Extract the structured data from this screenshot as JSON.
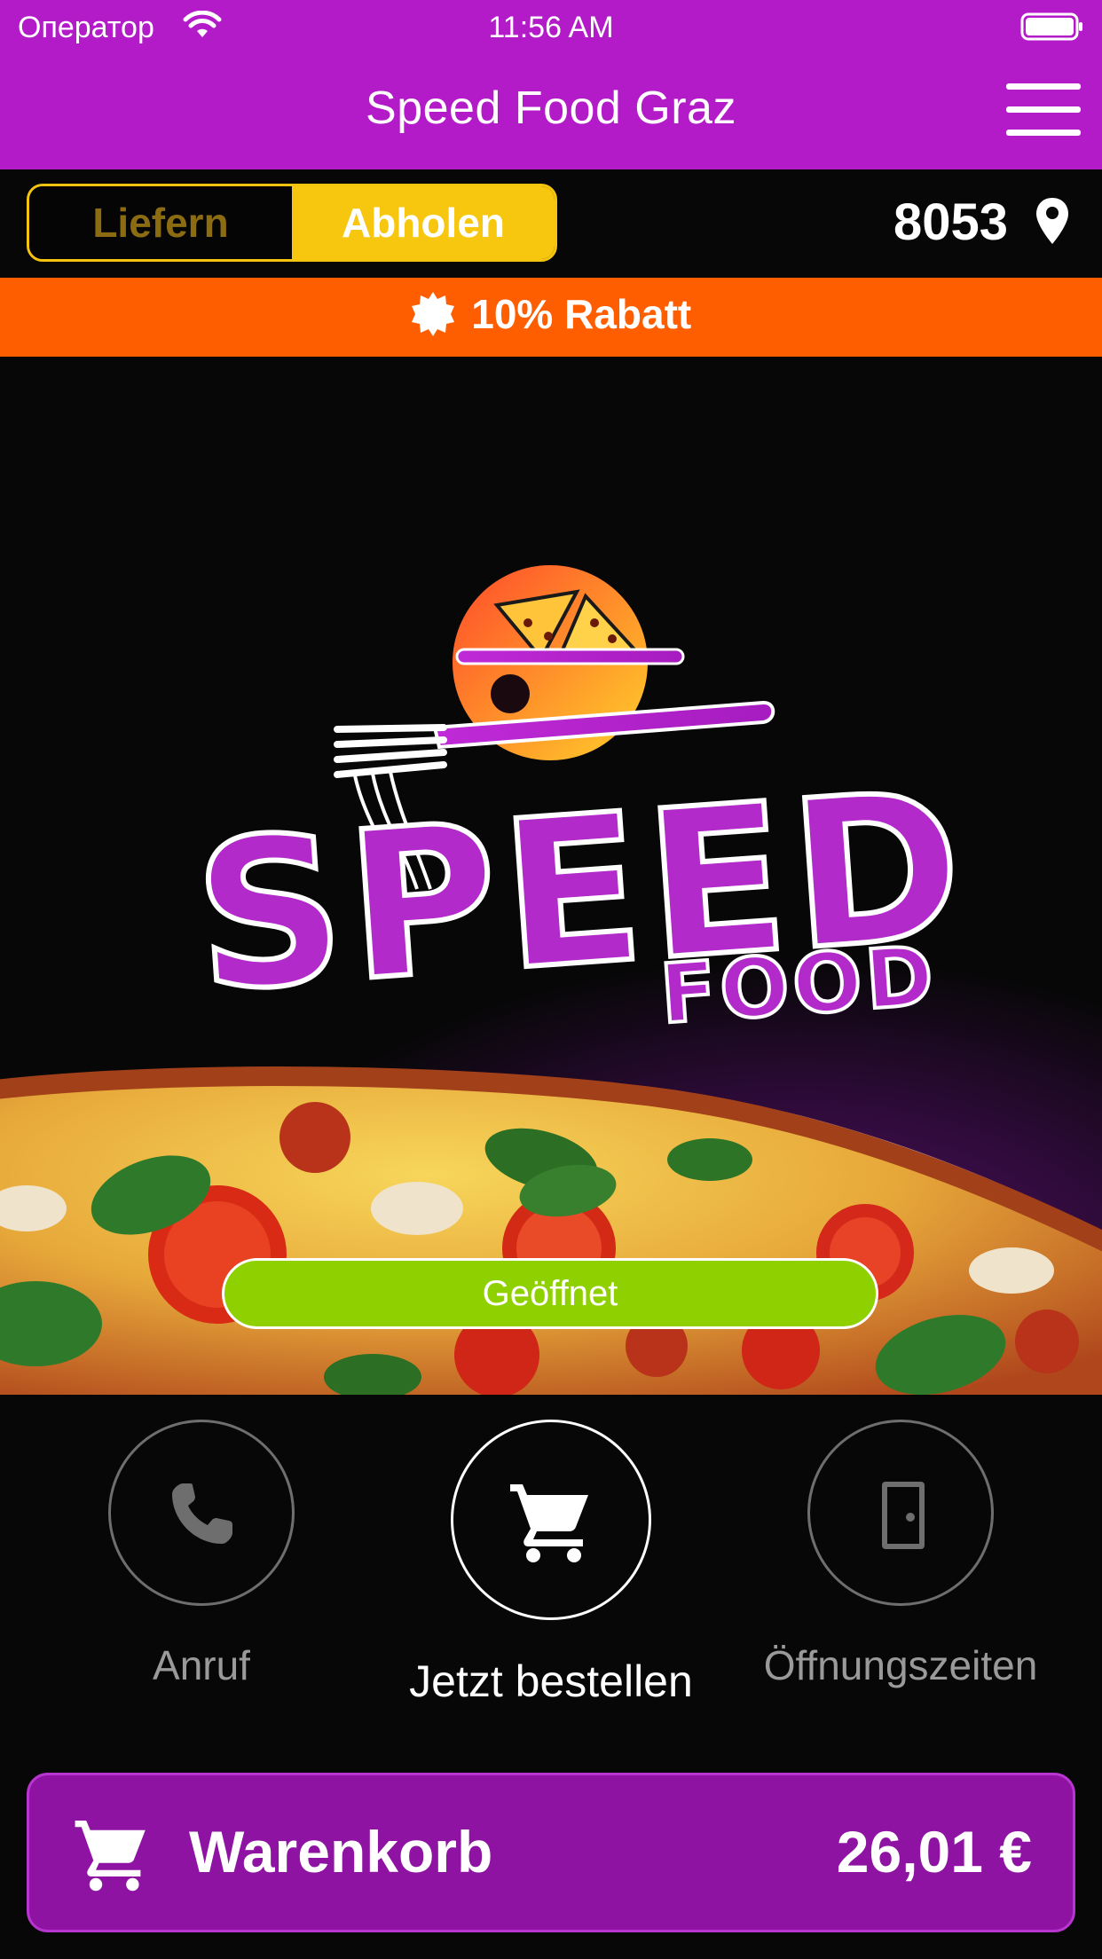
{
  "status_bar": {
    "carrier": "Оператор",
    "time": "11:56 AM"
  },
  "header": {
    "title": "Speed Food Graz",
    "menu_icon": "hamburger-menu-icon"
  },
  "mode_toggle": {
    "options": [
      "Liefern",
      "Abholen"
    ],
    "selected": "Abholen"
  },
  "location": {
    "postal_code": "8053",
    "icon": "location-pin-icon"
  },
  "discount": {
    "text": "10% Rabatt",
    "icon": "badge-icon"
  },
  "hero": {
    "logo_text_main": "SPEED",
    "logo_text_sub": "FOOD",
    "status": "Geöffnet"
  },
  "actions": [
    {
      "label": "Anruf",
      "icon": "phone-icon"
    },
    {
      "label": "Jetzt bestellen",
      "icon": "cart-icon"
    },
    {
      "label": "Öffnungszeiten",
      "icon": "door-icon"
    }
  ],
  "cart": {
    "label": "Warenkorb",
    "total": "26,01 €",
    "icon": "cart-icon"
  },
  "colors": {
    "header": "#b31bc9",
    "toggle_accent": "#f7c60f",
    "discount_banner": "#ff5e00",
    "open_status": "#8fd000",
    "cart_bar": "#8e13a2"
  }
}
